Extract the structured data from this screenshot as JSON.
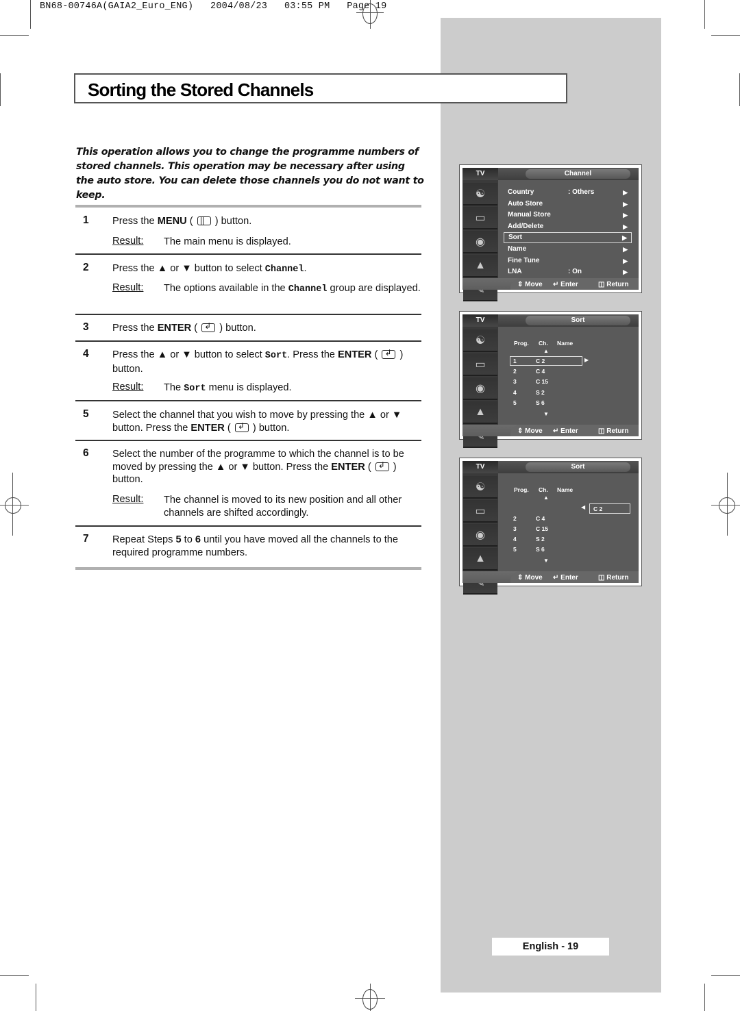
{
  "print_header": "BN68-00746A(GAIA2_Euro_ENG)   2004/08/23   03:55 PM   Page 19",
  "title": "Sorting the Stored Channels",
  "intro": "This operation allows you to change the programme numbers of stored channels. This operation may be necessary after using the auto store. You can delete those channels you do not want to keep.",
  "steps": [
    {
      "num": "1",
      "parts": {
        "a": "Press the ",
        "b": "MENU",
        "c": " ( ",
        "d": " ) button."
      },
      "result_label": "Result:",
      "result": "The main menu is displayed."
    },
    {
      "num": "2",
      "parts": {
        "a": "Press the ▲ or ▼ button to select ",
        "code": "Channel",
        "c": "."
      },
      "result_label": "Result:",
      "result": {
        "a": "The options available in the ",
        "code": "Channel",
        "c": " group are displayed."
      }
    },
    {
      "num": "3",
      "parts": {
        "a": "Press the ",
        "b": "ENTER",
        "c": " ( ",
        "d": " ) button."
      }
    },
    {
      "num": "4",
      "parts": {
        "a": "Press the ▲ or ▼ button to select ",
        "code": "Sort",
        "c": ". Press the ",
        "b": "ENTER",
        "d": " ( ",
        "e": " ) button."
      },
      "result_label": "Result:",
      "result": {
        "a": "The ",
        "code": "Sort",
        "c": " menu is displayed."
      }
    },
    {
      "num": "5",
      "parts": {
        "a": "Select the channel that you wish to move by pressing the ▲ or ▼ button. Press the ",
        "b": "ENTER",
        "c": " ( ",
        "d": " ) button."
      }
    },
    {
      "num": "6",
      "parts": {
        "a": "Select the number of the programme to which the channel is to be moved by pressing the ▲ or ▼ button. Press the ",
        "b": "ENTER",
        "c": " ( ",
        "d": " ) button."
      },
      "result_label": "Result:",
      "result": "The channel is moved to its new position and all other channels are shifted accordingly."
    },
    {
      "num": "7",
      "parts": {
        "a": "Repeat Steps ",
        "b1": "5",
        "m": " to ",
        "b2": "6",
        "c": " until you have moved all the channels to the required programme numbers."
      }
    }
  ],
  "screens": {
    "tv_label": "TV",
    "footer": {
      "move": "Move",
      "enter": "Enter",
      "return": "Return"
    },
    "channel_menu": {
      "title": "Channel",
      "items": [
        {
          "label": "Country",
          "value": ": Others"
        },
        {
          "label": "Auto Store",
          "value": ""
        },
        {
          "label": "Manual Store",
          "value": ""
        },
        {
          "label": "Add/Delete",
          "value": ""
        },
        {
          "label": "Sort",
          "value": "",
          "selected": true
        },
        {
          "label": "Name",
          "value": ""
        },
        {
          "label": "Fine Tune",
          "value": ""
        },
        {
          "label": "LNA",
          "value": ": On"
        }
      ]
    },
    "sort_1": {
      "title": "Sort",
      "columns": [
        "Prog.",
        "Ch.",
        "Name"
      ],
      "rows": [
        {
          "prog": "1",
          "ch": "C 2",
          "selected": true
        },
        {
          "prog": "2",
          "ch": "C 4"
        },
        {
          "prog": "3",
          "ch": "C 15"
        },
        {
          "prog": "4",
          "ch": "S 2"
        },
        {
          "prog": "5",
          "ch": "S 6"
        }
      ]
    },
    "sort_2": {
      "title": "Sort",
      "columns": [
        "Prog.",
        "Ch.",
        "Name"
      ],
      "moving": "C 2",
      "rows": [
        {
          "prog": "2",
          "ch": "C 4"
        },
        {
          "prog": "3",
          "ch": "C 15"
        },
        {
          "prog": "4",
          "ch": "S 2"
        },
        {
          "prog": "5",
          "ch": "S 6"
        }
      ]
    }
  },
  "page_label": "English - 19"
}
